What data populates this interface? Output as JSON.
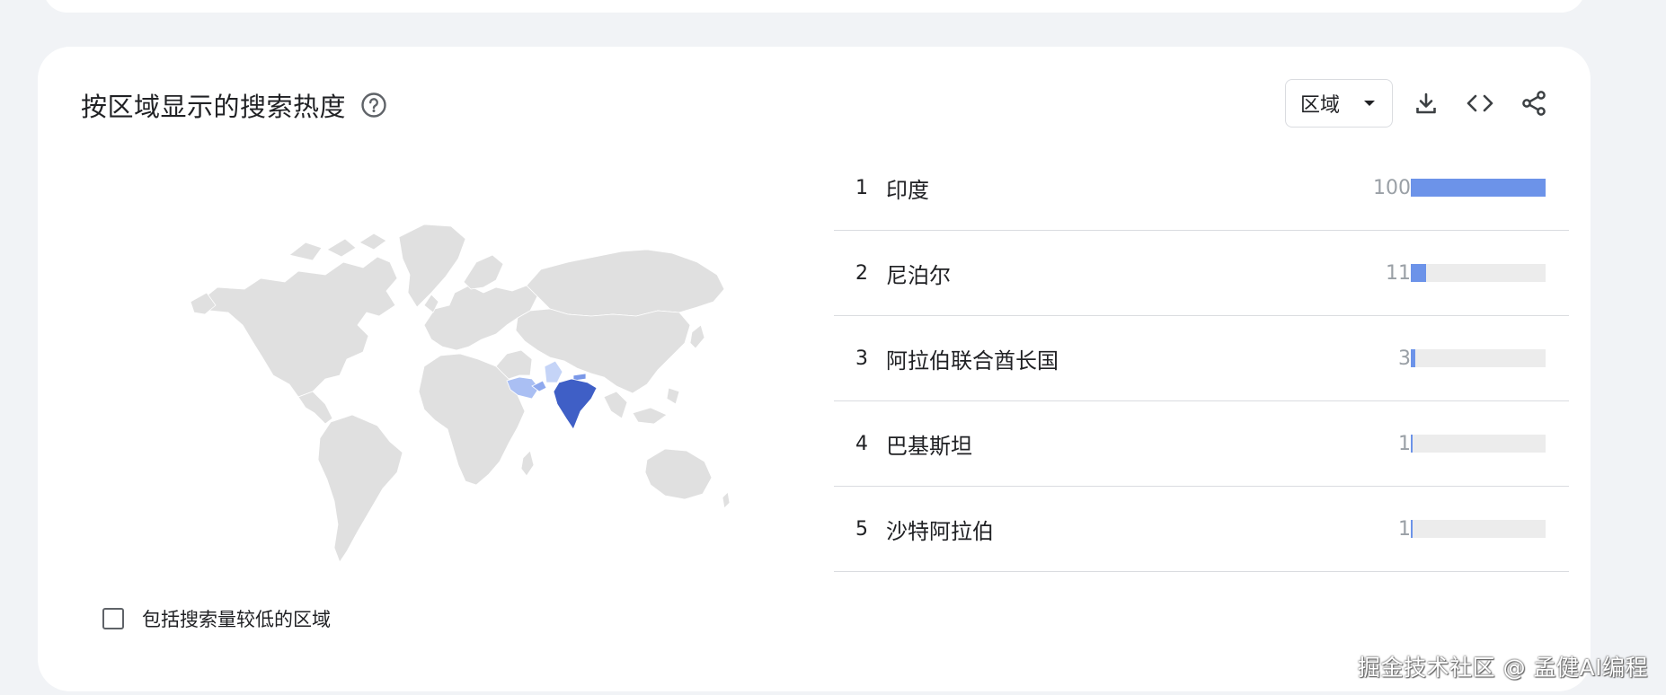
{
  "header": {
    "title": "按区域显示的搜索热度",
    "help_icon": "help-circle-icon"
  },
  "toolbar": {
    "resolution_select": "区域",
    "icons": [
      "download-icon",
      "embed-code-icon",
      "share-icon"
    ]
  },
  "map": {
    "highlight_colors": {
      "india": "#3f5fc6",
      "nepal": "#7a98e8",
      "uae": "#8fa9ee",
      "saudi_arabia": "#aabff3",
      "pakistan": "#c5d4f7",
      "other": "#e0e0e0"
    }
  },
  "regions": [
    {
      "rank": "1",
      "name": "印度",
      "value": "100",
      "pct": 100
    },
    {
      "rank": "2",
      "name": "尼泊尔",
      "value": "11",
      "pct": 11
    },
    {
      "rank": "3",
      "name": "阿拉伯联合酋长国",
      "value": "3",
      "pct": 3
    },
    {
      "rank": "4",
      "name": "巴基斯坦",
      "value": "1",
      "pct": 1
    },
    {
      "rank": "5",
      "name": "沙特阿拉伯",
      "value": "1",
      "pct": 1
    }
  ],
  "options": {
    "include_low_volume_label": "包括搜索量较低的区域",
    "include_low_volume_checked": false
  },
  "watermark": "掘金技术社区 @ 孟健AI编程",
  "colors": {
    "accent_bar": "#6c93e9",
    "bar_track": "#ececec",
    "card_bg": "#ffffff",
    "page_bg": "#f1f3f6"
  }
}
